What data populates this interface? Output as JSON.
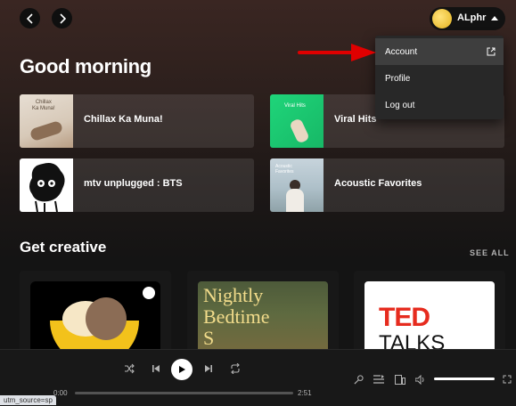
{
  "header": {
    "user_name": "ALphr"
  },
  "greeting": "Good morning",
  "shortcuts": [
    {
      "label": "Chillax Ka Muna!",
      "cover_text": "Chillax\nKa Muna!"
    },
    {
      "label": "Viral Hits",
      "cover_text": "Viral Hits"
    },
    {
      "label": "mtv unplugged : BTS"
    },
    {
      "label": "Acoustic Favorites",
      "cover_text": "Acoustic Favorites"
    }
  ],
  "section": {
    "title": "Get creative",
    "see_all": "SEE ALL"
  },
  "cards": [
    {
      "name": "sleep-podcast"
    },
    {
      "name": "Nightly Bedtime",
      "line1": "Nightly",
      "line2": "Bedtime",
      "line3": "S"
    },
    {
      "name": "TED Talks",
      "line1": "TED",
      "line2": "TALKS",
      "accent": "#e62b1e"
    }
  ],
  "user_menu": {
    "items": [
      {
        "label": "Account",
        "icon": "external-link-icon"
      },
      {
        "label": "Profile"
      },
      {
        "label": "Log out"
      }
    ]
  },
  "player": {
    "elapsed": "0:00",
    "duration": "2:51",
    "progress_fraction": 0.0,
    "volume_fraction": 1.0
  },
  "status_bar": "utm_source=sp",
  "colors": {
    "accent_green": "#1ed760",
    "arrow_red": "#e00000"
  }
}
